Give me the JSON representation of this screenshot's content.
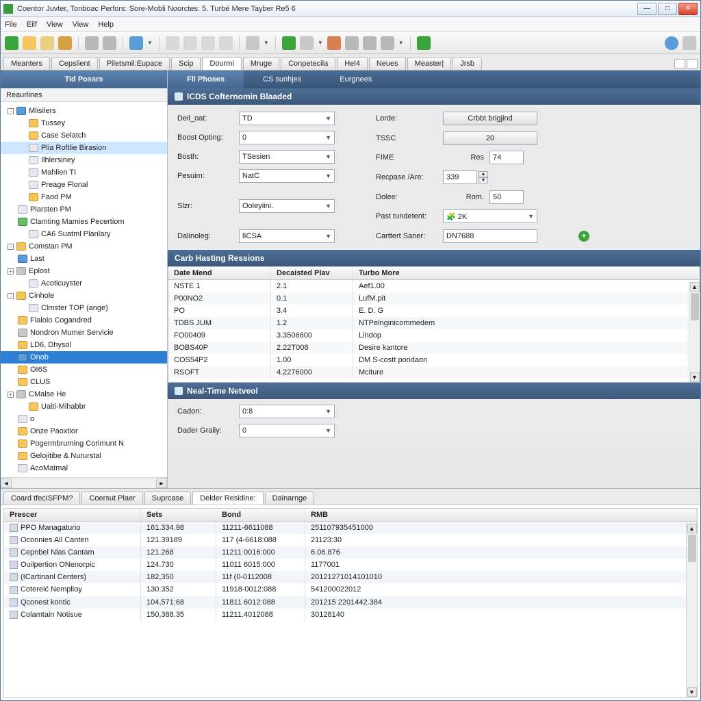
{
  "window": {
    "title": "Coentor Juvter, Tonboac Perfors: Sore-Mobli Noorctes: 5. Turbé Mere Tayber Re5 6"
  },
  "menu": {
    "file": "File",
    "eilf": "Eilf",
    "view1": "View",
    "view2": "View",
    "help": "Help"
  },
  "tabs": {
    "items": [
      "Meanters",
      "Cepslient",
      "Piletsmil:Eupace",
      "Scip",
      "Dourmi",
      "Mruge",
      "Conpetecila",
      "Hel4",
      "Neues",
      "Measter|",
      "Jrsb"
    ],
    "activeIndex": 4
  },
  "leftPanel": {
    "tabActive": "Tid Possrs",
    "subheader": "Reaurlines",
    "tree": [
      {
        "d": 0,
        "exp": "-",
        "ic": "ic-blue",
        "t": "Mlisilers"
      },
      {
        "d": 1,
        "ic": "ic-folder",
        "t": "Tussey"
      },
      {
        "d": 1,
        "ic": "ic-folder",
        "t": "Case Selatch"
      },
      {
        "d": 1,
        "ic": "ic-doc",
        "t": "Plia Roftlie Birasion",
        "sel": true
      },
      {
        "d": 1,
        "ic": "ic-doc",
        "t": "Ilhlersiney"
      },
      {
        "d": 1,
        "ic": "ic-doc",
        "t": "Mahlien TI"
      },
      {
        "d": 1,
        "ic": "ic-doc",
        "t": "Preage Flonal"
      },
      {
        "d": 1,
        "ic": "ic-folder",
        "t": "Faod PM"
      },
      {
        "d": 0,
        "ic": "ic-doc",
        "t": "Plarsten PM"
      },
      {
        "d": 0,
        "ic": "ic-green",
        "t": "Clamting Mamies Pecertiom"
      },
      {
        "d": 1,
        "ic": "ic-doc",
        "t": "CA6 Suatml Planlary"
      },
      {
        "d": 0,
        "exp": "-",
        "ic": "ic-folder",
        "t": "Comstan PM"
      },
      {
        "d": 0,
        "ic": "ic-blue",
        "t": "Last"
      },
      {
        "d": 0,
        "exp": "+",
        "ic": "ic-gray",
        "t": "Eplost"
      },
      {
        "d": 1,
        "ic": "ic-doc",
        "t": "Acoticuyster"
      },
      {
        "d": 0,
        "exp": "-",
        "ic": "ic-folder",
        "t": "Cinhole"
      },
      {
        "d": 1,
        "ic": "ic-doc",
        "t": "Clmster TOP (ange)"
      },
      {
        "d": 0,
        "ic": "ic-folder",
        "t": "Flalolo Cogandred"
      },
      {
        "d": 0,
        "ic": "ic-gray",
        "t": "Nondron Mumer Servicie"
      },
      {
        "d": 0,
        "ic": "ic-folder",
        "t": "LD6, Dhysol"
      },
      {
        "d": 0,
        "ic": "ic-blue",
        "t": "Onob",
        "selblue": true
      },
      {
        "d": 0,
        "ic": "ic-folder",
        "t": "OI6S"
      },
      {
        "d": 0,
        "ic": "ic-folder",
        "t": "CLUS"
      },
      {
        "d": 0,
        "exp": "+",
        "ic": "ic-gray",
        "t": "CMalse He"
      },
      {
        "d": 1,
        "ic": "ic-folder",
        "t": "Ualti-Mihabbr"
      },
      {
        "d": 0,
        "ic": "ic-doc",
        "t": "o"
      },
      {
        "d": 0,
        "ic": "ic-folder",
        "t": "Onze Paoxtior"
      },
      {
        "d": 0,
        "ic": "ic-folder",
        "t": "Pogermbruming Corimunt N"
      },
      {
        "d": 0,
        "ic": "ic-folder",
        "t": "Gelojitibe & Nururstal"
      },
      {
        "d": 0,
        "ic": "ic-doc",
        "t": "AcoMatmal"
      }
    ]
  },
  "rightTabs": {
    "items": [
      "Fll Phoses",
      "CS sunhjes",
      "Eurgnees"
    ],
    "activeIndex": 0
  },
  "section1": {
    "title": "ICDS Cofternomin Blaaded",
    "labels": {
      "deil": "Deil_oat:",
      "boost": "Boost Opting:",
      "bosth": "Bosth:",
      "pesuim": "Pesuim:",
      "slzr": "Slzr:",
      "dalin": "Dalinoleg:",
      "lorde": "Lorde:",
      "tssc": "TSSC",
      "fime": "FIME",
      "fime_sub": "Res",
      "recpase": "Recpase /Are:",
      "dolee": "Dolee:",
      "dolee_sub": "Rom.",
      "past": "Past tundetent:",
      "cartent": "Carttert Saner:"
    },
    "values": {
      "deil": "TD",
      "boost": "0",
      "bosth": "TSesien",
      "pesuim": "NatC",
      "slzr": "Ooleyiini.",
      "dalin": "lICSA",
      "lorde_btn": "Crbbt brigjind",
      "tssc": "20",
      "fime": "74",
      "recpase": "339",
      "dolee": "50",
      "past": "2K",
      "cartent": "DN7688"
    }
  },
  "section2": {
    "title": "Carb Hasting Ressions",
    "cols": [
      "Date Mend",
      "Decaisted Plav",
      "Turbo More"
    ],
    "rows": [
      [
        "NSTE 1",
        "2.1",
        "Aef1.00"
      ],
      [
        "P00NO2",
        "0.1",
        "LufM.pit"
      ],
      [
        "PO",
        "3.4",
        "E. D. G"
      ],
      [
        "TDBS JUM",
        "1.2",
        "NTPelnginicommedem"
      ],
      [
        "FO00409",
        "3.3506800",
        "Lindop"
      ],
      [
        "BOBS40P",
        "2.22T008",
        "Desire kantore"
      ],
      [
        "COS54P2",
        "1.00",
        "DM S-costt pondaon"
      ],
      [
        "RSOFT",
        "4.2276000",
        "Mciture"
      ]
    ]
  },
  "section3": {
    "title": "Neal-Time Netveol",
    "labels": {
      "cadon": "Cadon:",
      "dader": "Dader Graliy:"
    },
    "values": {
      "cadon": "0:8",
      "dader": "0"
    }
  },
  "lowerTabs": {
    "items": [
      "Coard tfecISFPM?",
      "Coersut Plaer",
      "Suprcase",
      "Delder Residine:",
      "Dainarnge"
    ],
    "activeIndex": 3
  },
  "lowerGrid": {
    "cols": [
      "Prescer",
      "Sets",
      "Bond",
      "RMB"
    ],
    "rows": [
      [
        "PPO Managaturio",
        "161.334.98",
        "11211-6611088",
        "251107935451000"
      ],
      [
        "Oconnies All Canten",
        "121.39189",
        "117 (4-6618:088",
        "21123:30"
      ],
      [
        "Cepnbel Nlas Cantam",
        "121.268",
        "11211 0016:000",
        "6.06.876"
      ],
      [
        "Ouilpertion ONenorpic",
        "124.730",
        "11011 6015:000",
        "1177001"
      ],
      [
        "(ICartinanl Centers)",
        "182,350",
        "11f (0-0112008",
        "20121271014101010"
      ],
      [
        "Cotereić Nemplioy",
        "130.352",
        "11918-0012:088",
        "541200022012"
      ],
      [
        "Qconest kontic",
        "104,571:68",
        "11811 6012:088",
        "201215 2201442.384"
      ],
      [
        "Colamtain Notisue",
        "150,388.35",
        "11211.4012088",
        "30128140"
      ]
    ]
  }
}
